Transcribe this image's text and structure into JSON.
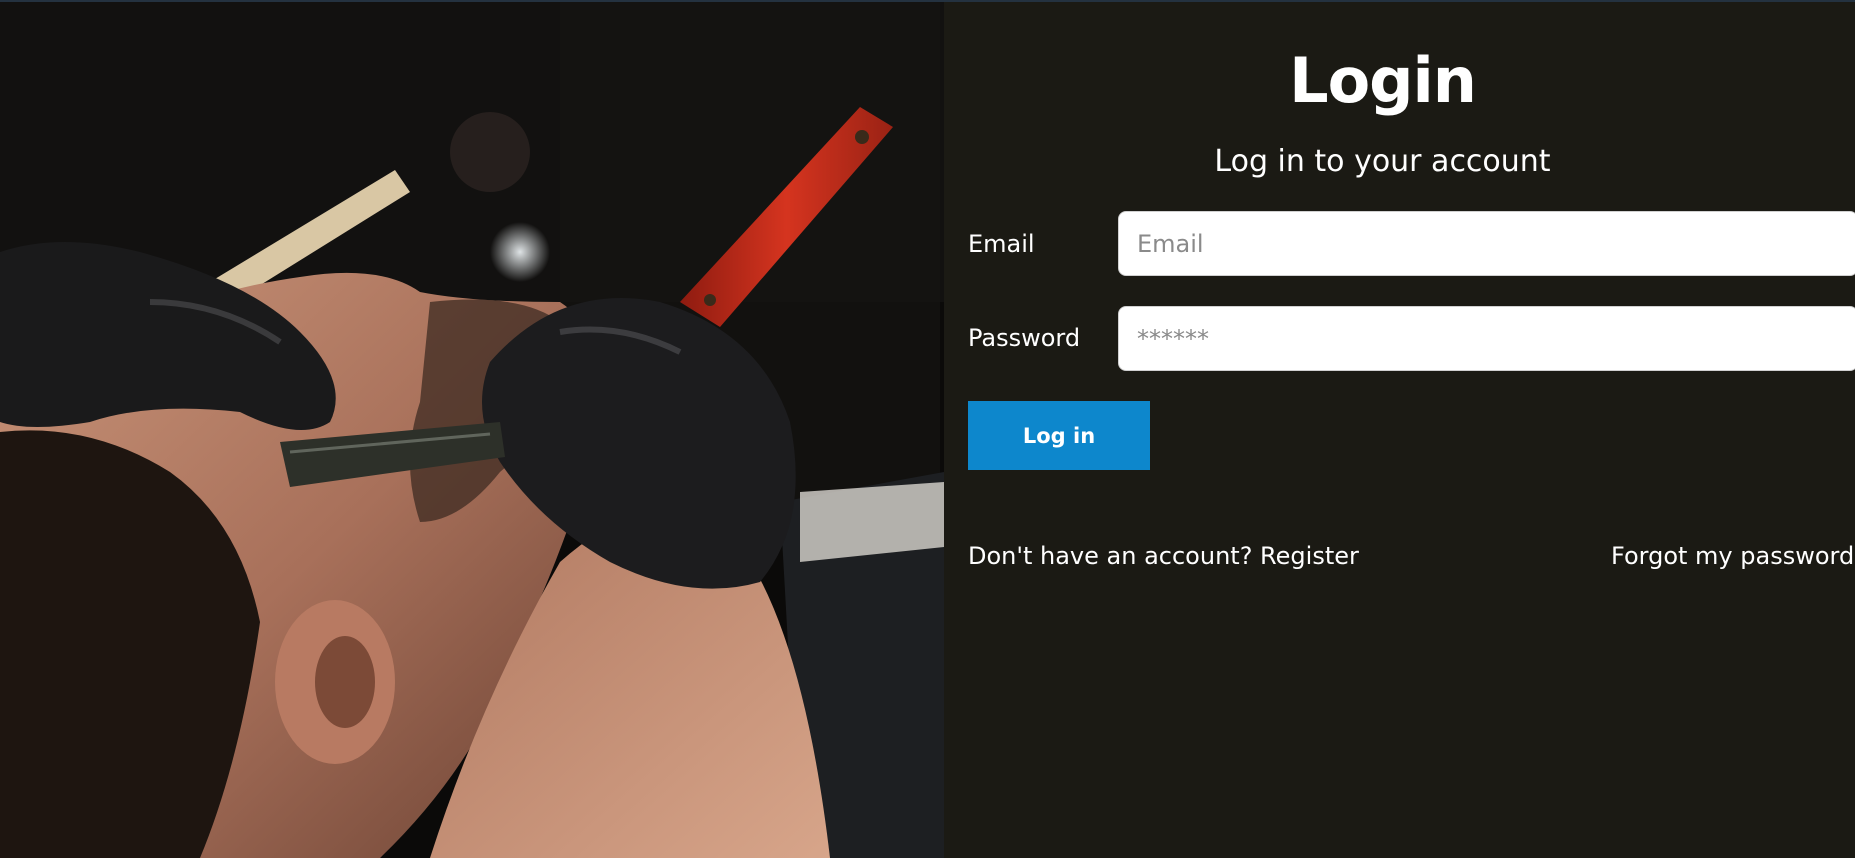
{
  "hero": {
    "image_alt": "Barber shaving a man's beard with a straight razor"
  },
  "login": {
    "title": "Login",
    "subtitle": "Log in to your account",
    "email_label": "Email",
    "email_placeholder": "Email",
    "email_value": "",
    "password_label": "Password",
    "password_placeholder": "******",
    "password_value": "",
    "submit_label": "Log in",
    "register_link": "Don't have an account? Register",
    "forgot_link": "Forgot my password"
  },
  "colors": {
    "panel_background": "#1b1a14",
    "button_background": "#0d87cc",
    "text": "#ffffff"
  }
}
